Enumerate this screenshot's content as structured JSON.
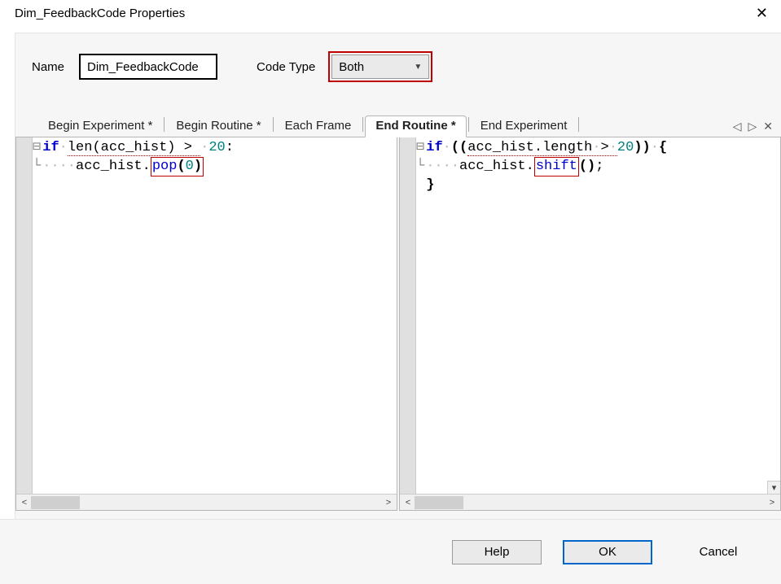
{
  "window": {
    "title": "Dim_FeedbackCode Properties"
  },
  "header": {
    "name_label": "Name",
    "name_value": "Dim_FeedbackCode",
    "codetype_label": "Code Type",
    "codetype_value": "Both"
  },
  "tabs": {
    "items": [
      {
        "label": "Begin Experiment *",
        "active": false
      },
      {
        "label": "Begin Routine *",
        "active": false
      },
      {
        "label": "Each Frame",
        "active": false
      },
      {
        "label": "End Routine *",
        "active": true
      },
      {
        "label": "End Experiment",
        "active": false
      }
    ],
    "controls": {
      "prev": "◁",
      "next": "▷",
      "close": "✕"
    }
  },
  "code_left": {
    "line1_kw": "if",
    "line1_rest_a": "len(",
    "line1_var": "acc_hist",
    "line1_rest_b": ") > ",
    "line1_num": "20",
    "line1_colon": ":",
    "line2_indent": "····",
    "line2_var": "acc_hist.",
    "line2_method": "pop",
    "line2_arg_open": "(",
    "line2_arg_num": "0",
    "line2_arg_close": ")"
  },
  "code_right": {
    "line1_kw": "if",
    "line1_open": " ((",
    "line1_var": "acc_hist",
    "line1_prop": ".length",
    "line1_rest": " > ",
    "line1_num": "20",
    "line1_close": ")) {",
    "line2_indent": "····",
    "line2_var": "acc_hist.",
    "line2_method": "shift",
    "line2_call": "();",
    "line3": "}"
  },
  "buttons": {
    "help": "Help",
    "ok": "OK",
    "cancel": "Cancel"
  }
}
